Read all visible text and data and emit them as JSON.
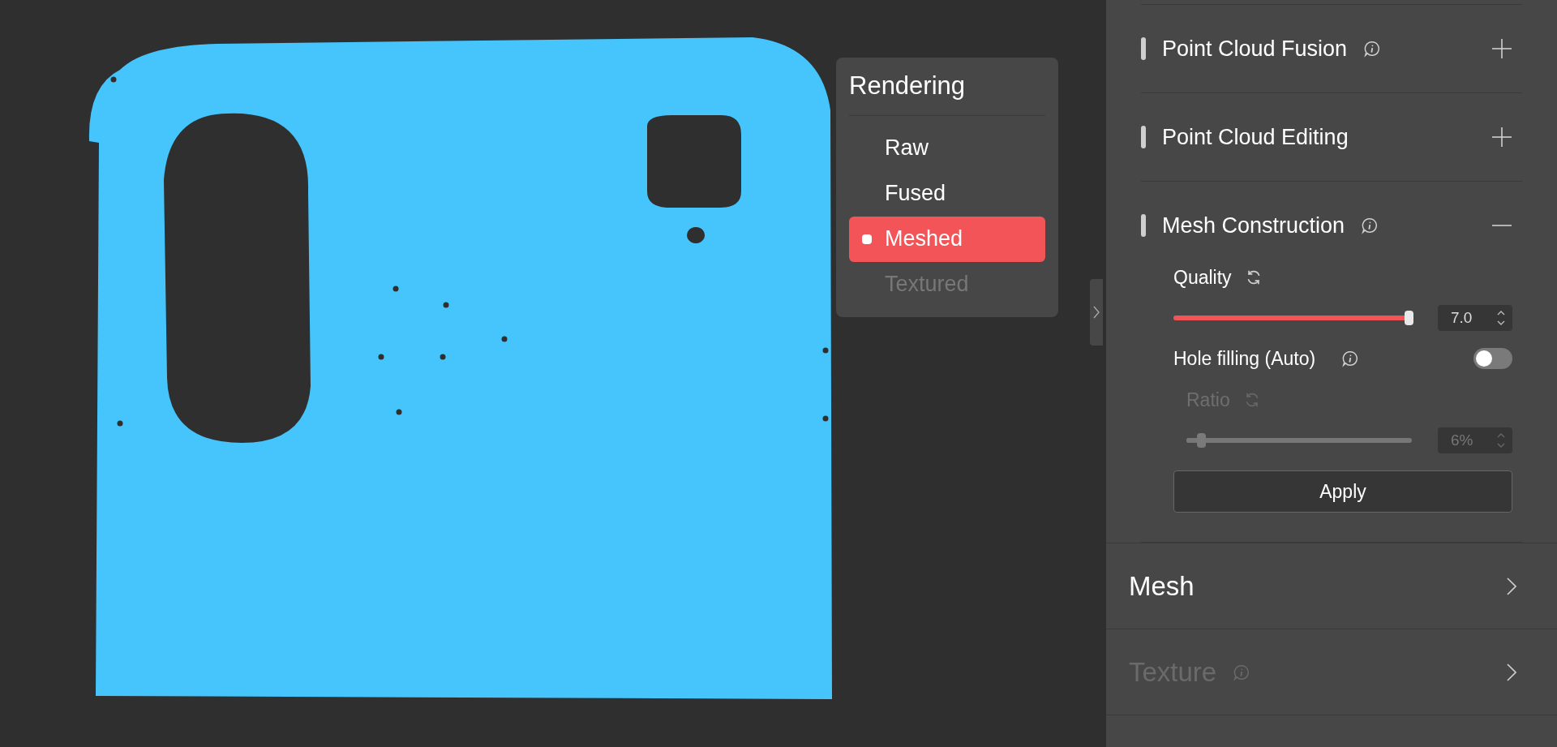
{
  "rendering_menu": {
    "title": "Rendering",
    "options": [
      {
        "label": "Raw",
        "selected": false,
        "disabled": false
      },
      {
        "label": "Fused",
        "selected": false,
        "disabled": false
      },
      {
        "label": "Meshed",
        "selected": true,
        "disabled": false
      },
      {
        "label": "Textured",
        "selected": false,
        "disabled": true
      }
    ]
  },
  "sections": [
    {
      "title": "Point Cloud Fusion",
      "info": true,
      "expanded": false
    },
    {
      "title": "Point Cloud Editing",
      "info": false,
      "expanded": false
    },
    {
      "title": "Mesh Construction",
      "info": true,
      "expanded": true,
      "quality": {
        "label": "Quality",
        "level": 1.0,
        "value": "7.0"
      },
      "hole_filling": {
        "label": "Hole filling (Auto)",
        "on": false
      },
      "ratio": {
        "label": "Ratio",
        "level": 0.05,
        "value": "6%",
        "disabled": true
      },
      "apply": "Apply"
    }
  ],
  "categories": [
    {
      "title": "Mesh",
      "disabled": false,
      "info": false
    },
    {
      "title": "Texture",
      "disabled": true,
      "info": true
    }
  ]
}
